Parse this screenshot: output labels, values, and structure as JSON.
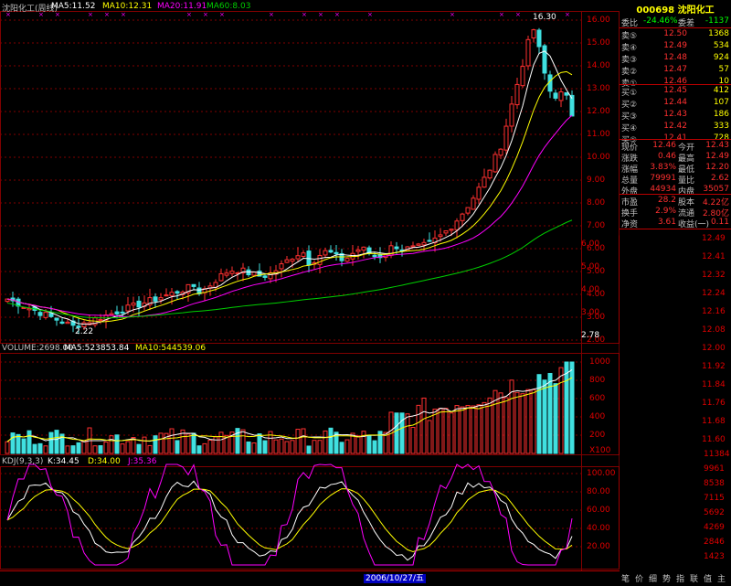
{
  "header": {
    "title": "沈阳化工(周线)",
    "ma5": "MA5:11.52",
    "ma10": "MA10:12.31",
    "ma20": "MA20:11.91",
    "ma60": "MA60:8.03"
  },
  "price_axis": [
    "16.00",
    "15.00",
    "14.00",
    "13.00",
    "12.00",
    "11.00",
    "10.00",
    "9.00",
    "8.00",
    "7.00",
    "6.00",
    "5.00",
    "4.00",
    "3.00",
    "2.00"
  ],
  "markers": {
    "high": "16.30",
    "low": "2.22"
  },
  "volume_header": {
    "title": "VOLUME:2698.00",
    "ma5": "MA5:523853.84",
    "ma10": "MA10:544539.06"
  },
  "volume_axis": [
    "1000",
    "800",
    "600",
    "400",
    "200",
    "X100"
  ],
  "kdj_header": {
    "title": "KDJ(9,3,3)",
    "k": "K:34.45",
    "d": "D:34.00",
    "j": "J:35.36"
  },
  "kdj_axis": [
    "100.00",
    "80.00",
    "60.00",
    "40.00",
    "20.00"
  ],
  "date_label": "2006/10/27/五",
  "quote": {
    "code": "000698",
    "name": "沈阳化工",
    "ratio_label": "委比",
    "ratio": "-24.46%",
    "diff_label": "委差",
    "diff": "-1137",
    "asks": [
      {
        "label": "卖⑤",
        "price": "12.50",
        "vol": "1368"
      },
      {
        "label": "卖④",
        "price": "12.49",
        "vol": "534"
      },
      {
        "label": "卖③",
        "price": "12.48",
        "vol": "924"
      },
      {
        "label": "卖②",
        "price": "12.47",
        "vol": "57"
      },
      {
        "label": "卖①",
        "price": "12.46",
        "vol": "10"
      }
    ],
    "bids": [
      {
        "label": "买①",
        "price": "12.45",
        "vol": "412"
      },
      {
        "label": "买②",
        "price": "12.44",
        "vol": "107"
      },
      {
        "label": "买③",
        "price": "12.43",
        "vol": "186"
      },
      {
        "label": "买④",
        "price": "12.42",
        "vol": "333"
      },
      {
        "label": "买⑤",
        "price": "12.41",
        "vol": "728"
      }
    ],
    "stats": [
      {
        "l1": "现价",
        "v1": "12.46",
        "l2": "今开",
        "v2": "12.43"
      },
      {
        "l1": "涨跌",
        "v1": "0.46",
        "l2": "最高",
        "v2": "12.49"
      },
      {
        "l1": "涨幅",
        "v1": "3.83%",
        "l2": "最低",
        "v2": "12.20"
      },
      {
        "l1": "总量",
        "v1": "79991",
        "l2": "量比",
        "v2": "2.62"
      },
      {
        "l1": "外盘",
        "v1": "44934",
        "l2": "内盘",
        "v2": "35057"
      }
    ],
    "fund": [
      {
        "l1": "市盈",
        "v1": "28.2",
        "l2": "股本",
        "v2": "4.22亿"
      },
      {
        "l1": "换手",
        "v1": "2.9%",
        "l2": "流通",
        "v2": "2.80亿"
      },
      {
        "l1": "净资",
        "v1": "3.61",
        "l2": "收益(一)",
        "v2": "0.11"
      }
    ],
    "intraday_axis": [
      "12.49",
      "12.41",
      "12.32",
      "12.24",
      "12.16",
      "12.08",
      "12.00",
      "11.92",
      "11.84",
      "11.76",
      "11.68",
      "11.60"
    ],
    "left_axis": [
      "6.00",
      "5.00",
      "4.00",
      "3.00",
      "2.78"
    ],
    "vol_axis": [
      "11384",
      "9961",
      "8538",
      "7115",
      "5692",
      "4269",
      "2846",
      "1423"
    ],
    "tabs": [
      "笔",
      "价",
      "细",
      "势",
      "指",
      "联",
      "值",
      "主"
    ]
  },
  "colors": {
    "up": "#ff3030",
    "down": "#40e0e0",
    "ma5": "#ffffff",
    "ma10": "#ffff00",
    "ma20": "#ff00ff",
    "ma60": "#00d000",
    "grid": "#800000"
  }
}
